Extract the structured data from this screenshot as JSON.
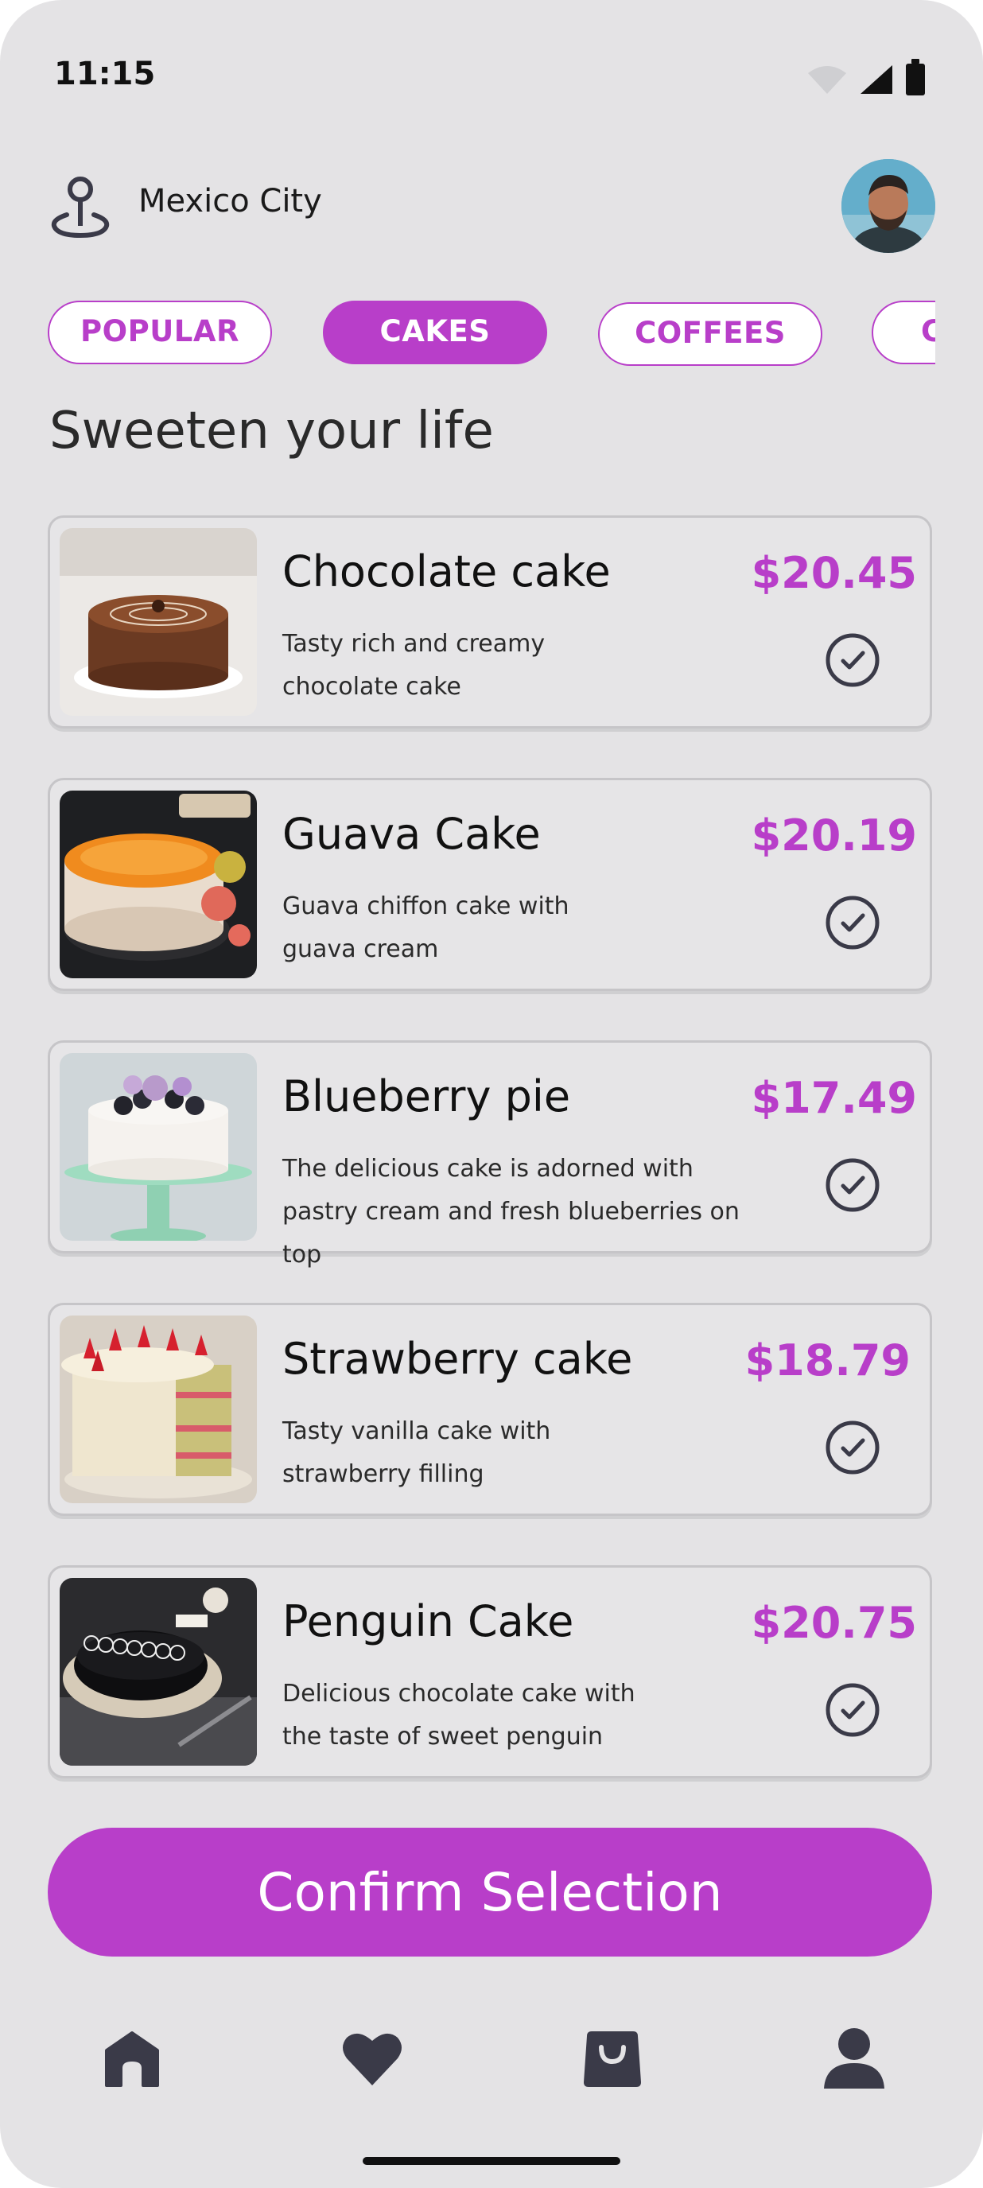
{
  "status_bar": {
    "time": "11:15"
  },
  "header": {
    "location": "Mexico City"
  },
  "tabs": [
    {
      "label": "POPULAR",
      "active": false
    },
    {
      "label": "CAKES",
      "active": true
    },
    {
      "label": "COFFEES",
      "active": false
    },
    {
      "label": "C",
      "active": false
    }
  ],
  "section_title": "Sweeten your life",
  "products": [
    {
      "name": "Chocolate cake",
      "description": "Tasty rich and creamy chocolate cake",
      "price": "$20.45"
    },
    {
      "name": "Guava Cake",
      "description": "Guava chiffon cake with guava cream",
      "price": "$20.19"
    },
    {
      "name": "Blueberry pie",
      "description": "The delicious cake is adorned with pastry cream and fresh blueberries on top",
      "price": "$17.49"
    },
    {
      "name": "Strawberry cake",
      "description": "Tasty vanilla cake with strawberry filling",
      "price": "$18.79"
    },
    {
      "name": "Penguin Cake",
      "description": "Delicious chocolate cake with the taste of sweet penguin",
      "price": "$20.75"
    }
  ],
  "confirm_label": "Confirm Selection",
  "bottom_nav": [
    "home-icon",
    "heart-icon",
    "bag-icon",
    "profile-icon"
  ],
  "colors": {
    "accent": "#b83ec9",
    "background": "#e4e3e5",
    "icon": "#3a3a48"
  }
}
